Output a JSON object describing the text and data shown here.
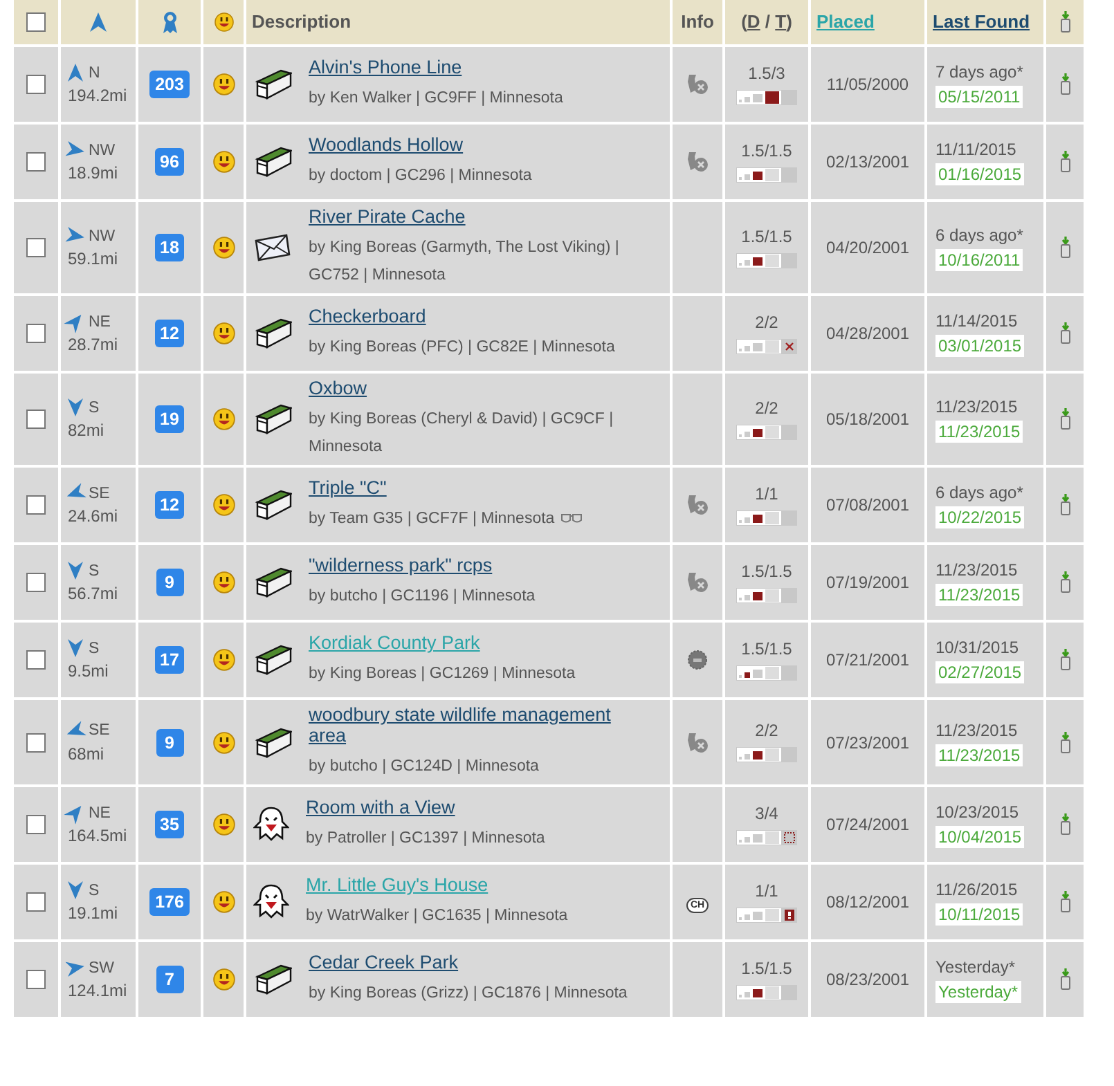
{
  "header": {
    "checked": false,
    "description": "Description",
    "info": "Info",
    "dt_open": "(",
    "dt_d": "D",
    "dt_sep": " / ",
    "dt_t": "T",
    "dt_close": ")",
    "placed": "Placed",
    "last_found": "Last Found"
  },
  "rows": [
    {
      "checked": false,
      "arrow": {
        "kind": "n"
      },
      "direction": "N",
      "distance": "194.2mi",
      "favorites": "203",
      "icon": {
        "kind": "traditional"
      },
      "title": "Alvin's Phone Line",
      "visited": false,
      "byline": "by Ken Walker | GC9FF | Minnesota",
      "watched": false,
      "info": {
        "kind": "trackable"
      },
      "dt": "1.5/3",
      "size": {
        "kind": "large"
      },
      "placed": "11/05/2000",
      "last_found": "7 days ago*",
      "my_found": "05/15/2011"
    },
    {
      "checked": false,
      "arrow": {
        "kind": "nw"
      },
      "direction": "NW",
      "distance": "18.9mi",
      "favorites": "96",
      "icon": {
        "kind": "traditional"
      },
      "title": "Woodlands Hollow",
      "visited": false,
      "byline": "by doctom | GC296 | Minnesota",
      "watched": false,
      "info": {
        "kind": "trackable"
      },
      "dt": "1.5/1.5",
      "size": {
        "kind": "regular"
      },
      "placed": "02/13/2001",
      "last_found": "11/11/2015",
      "my_found": "01/16/2015"
    },
    {
      "checked": false,
      "arrow": {
        "kind": "nw"
      },
      "direction": "NW",
      "distance": "59.1mi",
      "favorites": "18",
      "icon": {
        "kind": "letterbox"
      },
      "title": "River Pirate Cache",
      "visited": false,
      "byline": "by King Boreas (Garmyth, The Lost Viking) | GC752 | Minnesota",
      "watched": false,
      "dt": "1.5/1.5",
      "size": {
        "kind": "regular"
      },
      "placed": "04/20/2001",
      "last_found": "6 days ago*",
      "my_found": "10/16/2011"
    },
    {
      "checked": false,
      "arrow": {
        "kind": "ne"
      },
      "direction": "NE",
      "distance": "28.7mi",
      "favorites": "12",
      "icon": {
        "kind": "traditional"
      },
      "title": "Checkerboard",
      "visited": false,
      "byline": "by King Boreas (PFC) | GC82E | Minnesota",
      "watched": false,
      "dt": "2/2",
      "size": {
        "kind": "not_chosen"
      },
      "placed": "04/28/2001",
      "last_found": "11/14/2015",
      "my_found": "03/01/2015"
    },
    {
      "checked": false,
      "arrow": {
        "kind": "s"
      },
      "direction": "S",
      "distance": "82mi",
      "favorites": "19",
      "icon": {
        "kind": "traditional"
      },
      "title": "Oxbow",
      "visited": false,
      "byline": "by King Boreas (Cheryl & David) | GC9CF | Minnesota",
      "watched": false,
      "dt": "2/2",
      "size": {
        "kind": "regular"
      },
      "placed": "05/18/2001",
      "last_found": "11/23/2015",
      "my_found": "11/23/2015"
    },
    {
      "checked": false,
      "arrow": {
        "kind": "se"
      },
      "direction": "SE",
      "distance": "24.6mi",
      "favorites": "12",
      "icon": {
        "kind": "traditional"
      },
      "title": "Triple \"C\"",
      "visited": false,
      "byline": "by Team G35 | GCF7F | Minnesota",
      "watched": true,
      "info": {
        "kind": "trackable"
      },
      "dt": "1/1",
      "size": {
        "kind": "regular"
      },
      "placed": "07/08/2001",
      "last_found": "6 days ago*",
      "my_found": "10/22/2015"
    },
    {
      "checked": false,
      "arrow": {
        "kind": "s"
      },
      "direction": "S",
      "distance": "56.7mi",
      "favorites": "9",
      "icon": {
        "kind": "traditional"
      },
      "title": "\"wilderness park\" rcps",
      "visited": false,
      "byline": "by butcho | GC1196 | Minnesota",
      "watched": false,
      "info": {
        "kind": "trackable"
      },
      "dt": "1.5/1.5",
      "size": {
        "kind": "regular"
      },
      "placed": "07/19/2001",
      "last_found": "11/23/2015",
      "my_found": "11/23/2015"
    },
    {
      "checked": false,
      "arrow": {
        "kind": "s"
      },
      "direction": "S",
      "distance": "9.5mi",
      "favorites": "17",
      "icon": {
        "kind": "traditional"
      },
      "title": "Kordiak County Park",
      "visited": true,
      "byline": "by King Boreas | GC1269 | Minnesota",
      "watched": false,
      "info": {
        "kind": "geocoin"
      },
      "dt": "1.5/1.5",
      "size": {
        "kind": "small"
      },
      "placed": "07/21/2001",
      "last_found": "10/31/2015",
      "my_found": "02/27/2015"
    },
    {
      "checked": false,
      "arrow": {
        "kind": "se"
      },
      "direction": "SE",
      "distance": "68mi",
      "favorites": "9",
      "icon": {
        "kind": "traditional"
      },
      "title": "woodbury state wildlife management area",
      "visited": false,
      "byline": "by butcho | GC124D | Minnesota",
      "watched": false,
      "info": {
        "kind": "trackable"
      },
      "dt": "2/2",
      "size": {
        "kind": "regular"
      },
      "placed": "07/23/2001",
      "last_found": "11/23/2015",
      "my_found": "11/23/2015"
    },
    {
      "checked": false,
      "arrow": {
        "kind": "ne"
      },
      "direction": "NE",
      "distance": "164.5mi",
      "favorites": "35",
      "icon": {
        "kind": "virtual"
      },
      "title": "Room with a View",
      "visited": false,
      "byline": "by Patroller | GC1397 | Minnesota",
      "watched": false,
      "dt": "3/4",
      "size": {
        "kind": "other"
      },
      "placed": "07/24/2001",
      "last_found": "10/23/2015",
      "my_found": "10/04/2015"
    },
    {
      "checked": false,
      "arrow": {
        "kind": "s"
      },
      "direction": "S",
      "distance": "19.1mi",
      "favorites": "176",
      "icon": {
        "kind": "virtual"
      },
      "title": "Mr. Little Guy's House",
      "visited": true,
      "byline": "by WatrWalker | GC1635 | Minnesota",
      "watched": false,
      "info": {
        "kind": "badge",
        "text": "CH"
      },
      "dt": "1/1",
      "size": {
        "kind": "unknown"
      },
      "placed": "08/12/2001",
      "last_found": "11/26/2015",
      "my_found": "10/11/2015"
    },
    {
      "checked": false,
      "arrow": {
        "kind": "sw"
      },
      "direction": "SW",
      "distance": "124.1mi",
      "favorites": "7",
      "icon": {
        "kind": "traditional"
      },
      "title": "Cedar Creek Park",
      "visited": false,
      "byline": "by King Boreas (Grizz) | GC1876 | Minnesota",
      "watched": false,
      "dt": "1.5/1.5",
      "size": {
        "kind": "regular"
      },
      "placed": "08/23/2001",
      "last_found": "Yesterday*",
      "my_found": "Yesterday*"
    }
  ]
}
